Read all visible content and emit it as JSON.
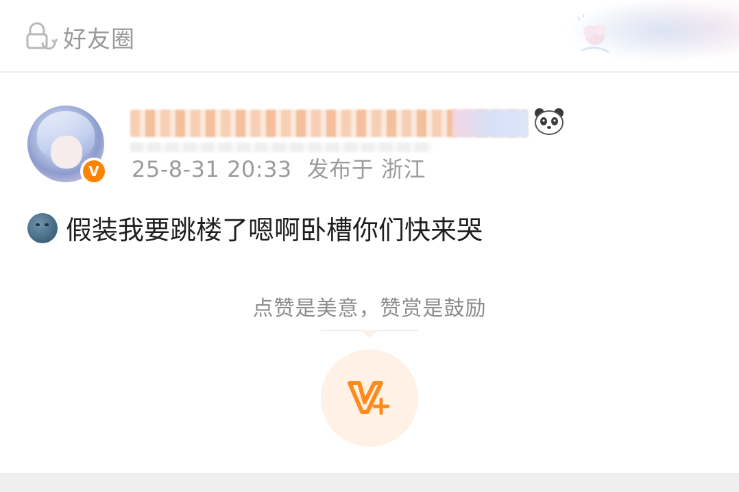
{
  "header": {
    "title": "好友圈",
    "icon": "lock-refresh-icon"
  },
  "post": {
    "author_badge": "V",
    "timestamp": "25-8-31 20:33",
    "location": "发布于 浙江",
    "emoji": "new-moon-face-emoji",
    "text": "假装我要跳楼了嗯啊卧槽你们快来哭"
  },
  "reward": {
    "hint": "点赞是美意，赞赏是鼓励",
    "button_icon": "reward-v-plus-icon"
  },
  "colors": {
    "brand_orange": "#ff8200",
    "meta_gray": "#9b9b9b",
    "reward_bg": "#fff1e6"
  }
}
